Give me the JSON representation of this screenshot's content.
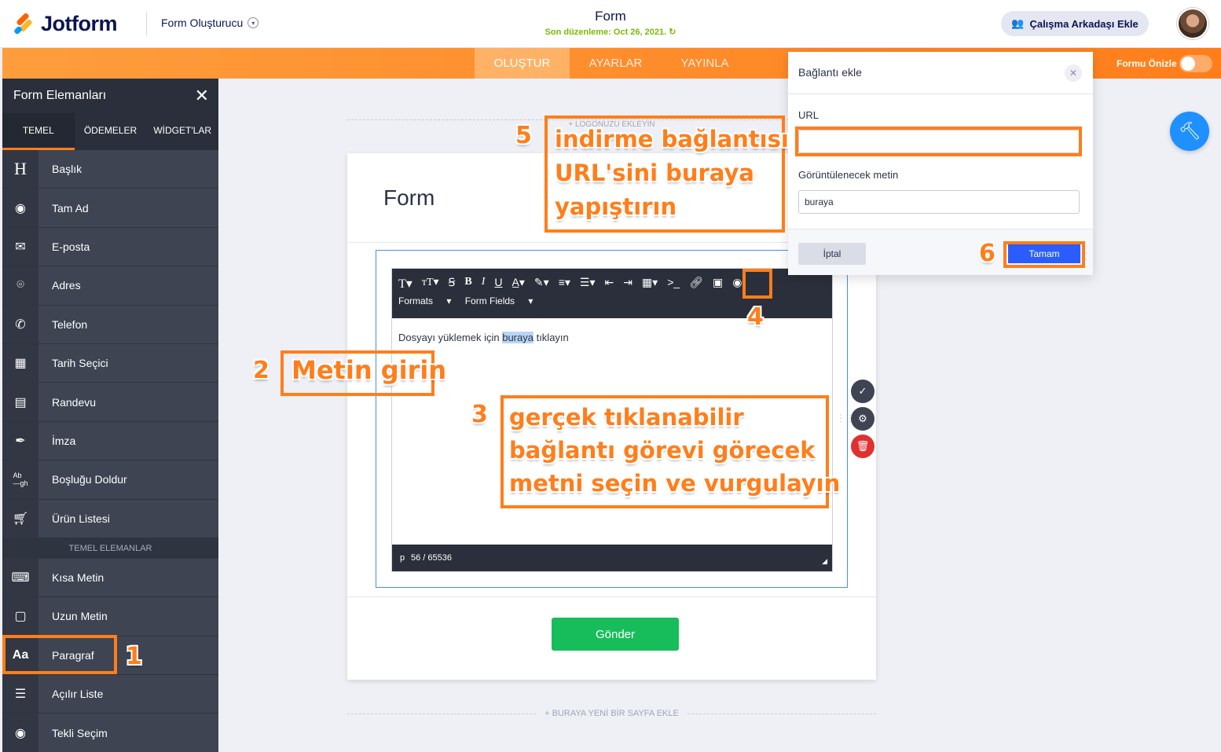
{
  "header": {
    "brand": "Jotform",
    "builder_menu": "Form Oluşturucu",
    "form_title": "Form",
    "last_edited": "Son düzenleme: Oct 26, 2021.",
    "add_collaborator": "Çalışma Arkadaşı Ekle"
  },
  "nav": {
    "tabs": [
      "OLUŞTUR",
      "AYARLAR",
      "YAYINLA"
    ],
    "active_tab": "OLUŞTUR",
    "preview_label": "Formu Önizle",
    "preview_on": false
  },
  "sidebar": {
    "title": "Form Elemanları",
    "tabs": [
      "TEMEL",
      "ÖDEMELER",
      "WİDGET'LAR"
    ],
    "items": [
      {
        "label": "Başlık",
        "icon": "heading-icon"
      },
      {
        "label": "Tam Ad",
        "icon": "user-icon"
      },
      {
        "label": "E-posta",
        "icon": "mail-icon"
      },
      {
        "label": "Adres",
        "icon": "location-icon"
      },
      {
        "label": "Telefon",
        "icon": "phone-icon"
      },
      {
        "label": "Tarih Seçici",
        "icon": "calendar-icon"
      },
      {
        "label": "Randevu",
        "icon": "appointment-icon"
      },
      {
        "label": "İmza",
        "icon": "signature-icon"
      },
      {
        "label": "Boşluğu Doldur",
        "icon": "fill-blank-icon"
      },
      {
        "label": "Ürün Listesi",
        "icon": "cart-icon"
      }
    ],
    "section": "TEMEL ELEMANLAR",
    "items2": [
      {
        "label": "Kısa Metin",
        "icon": "short-text-icon"
      },
      {
        "label": "Uzun Metin",
        "icon": "long-text-icon"
      },
      {
        "label": "Paragraf",
        "icon": "paragraph-icon",
        "glyph": "Aa"
      },
      {
        "label": "Açılır Liste",
        "icon": "dropdown-icon"
      },
      {
        "label": "Tekli Seçim",
        "icon": "radio-icon"
      }
    ]
  },
  "canvas": {
    "logo_placeholder": "+ LOGONUZU EKLEYİN",
    "form_heading": "Form",
    "editor": {
      "toolbar_menus": [
        "Formats",
        "Form Fields"
      ],
      "text_before": "Dosyayı yüklemek için ",
      "text_selected": "buraya",
      "text_after": " tıklayın",
      "status_tag": "p",
      "char_count": "56 / 65536"
    },
    "submit_label": "Gönder",
    "add_page": "+ BURAYA YENİ BİR SAYFA EKLE"
  },
  "link_dialog": {
    "title": "Bağlantı ekle",
    "url_label": "URL",
    "url_value": "",
    "text_label": "Görüntülenecek metin",
    "text_value": "buraya",
    "cancel": "İptal",
    "ok": "Tamam"
  },
  "annotations": {
    "n1": "1",
    "n2": "2",
    "t2": "Metin girin",
    "n3": "3",
    "t3": [
      "gerçek tıklanabilir",
      "bağlantı görevi görecek",
      "metni seçin ve vurgulayın"
    ],
    "n4": "4",
    "n5": "5",
    "t5": [
      "indirme bağlantısı",
      "URL'sini buraya",
      "yapıştırın"
    ],
    "n6": "6"
  },
  "colors": {
    "accent_orange": "#ff7e1b",
    "sidebar_bg": "#3e4452",
    "submit_green": "#18bd5b",
    "ok_blue": "#2a5cff",
    "wand_blue": "#1e90ff"
  }
}
